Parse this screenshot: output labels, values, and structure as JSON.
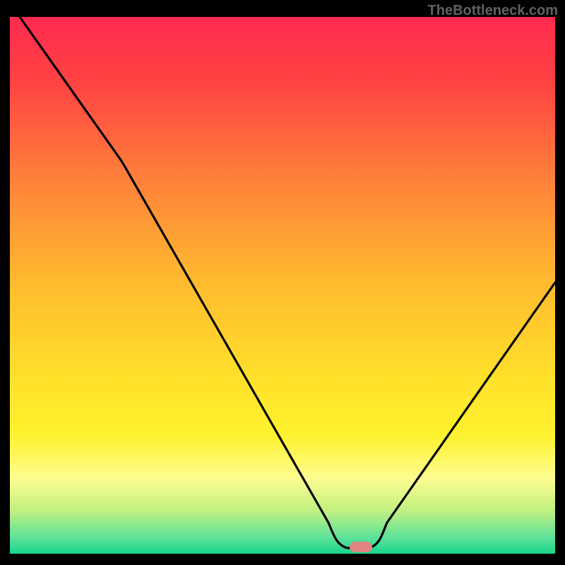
{
  "watermark": "TheBottleneck.com",
  "chart_data": {
    "type": "line",
    "title": "",
    "xlabel": "",
    "ylabel": "",
    "xlim": [
      0,
      100
    ],
    "ylim": [
      0,
      100
    ],
    "grid": false,
    "legend": false,
    "curve_points": [
      {
        "x": 2,
        "y": 100
      },
      {
        "x": 20,
        "y": 74
      },
      {
        "x": 58,
        "y": 5
      },
      {
        "x": 60,
        "y": 0.5
      },
      {
        "x": 66,
        "y": 0.5
      },
      {
        "x": 68,
        "y": 5
      },
      {
        "x": 100,
        "y": 55
      }
    ],
    "marker": {
      "x": 64,
      "y": 1.5,
      "color": "#d98080",
      "shape": "pill"
    },
    "background": {
      "type": "vertical_gradient",
      "stops": [
        {
          "pos": 0.0,
          "color": "#ff2b50"
        },
        {
          "pos": 0.12,
          "color": "#ff4242"
        },
        {
          "pos": 0.3,
          "color": "#ff803a"
        },
        {
          "pos": 0.5,
          "color": "#ffbc2e"
        },
        {
          "pos": 0.68,
          "color": "#ffe22a"
        },
        {
          "pos": 0.78,
          "color": "#fff22e"
        },
        {
          "pos": 0.86,
          "color": "#fdfd90"
        },
        {
          "pos": 0.92,
          "color": "#c0f080"
        },
        {
          "pos": 0.97,
          "color": "#5de29a"
        },
        {
          "pos": 1.0,
          "color": "#1ad48c"
        }
      ]
    },
    "frame_color": "#000000"
  }
}
